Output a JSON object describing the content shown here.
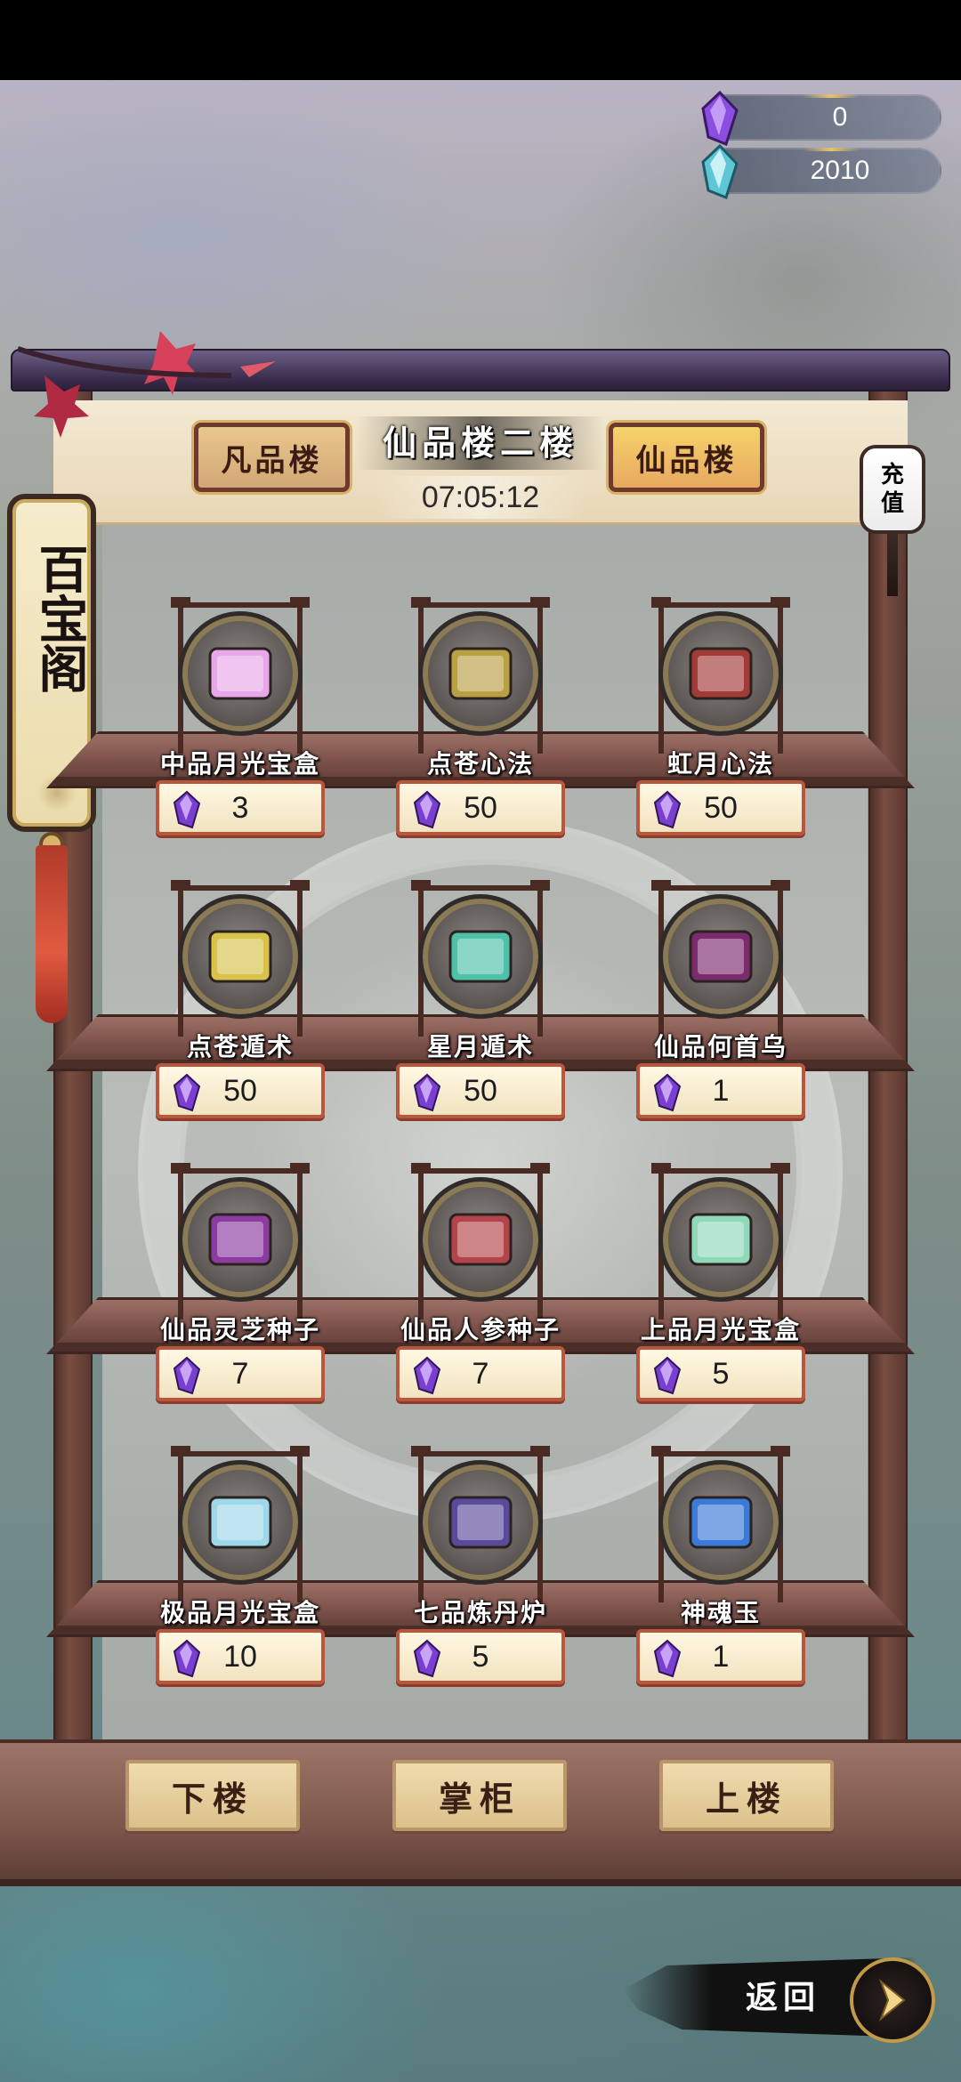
{
  "currency": {
    "purple": {
      "value": "0",
      "icon": "purple-gem-icon"
    },
    "blue": {
      "value": "2010",
      "icon": "blue-crystal-icon"
    }
  },
  "header": {
    "left_nav": "凡品楼",
    "title": "仙品楼二楼",
    "right_nav": "仙品楼",
    "timer": "07:05:12",
    "recharge_line1": "充",
    "recharge_line2": "值"
  },
  "side_sign": {
    "text": "百宝阁"
  },
  "items": [
    {
      "name": "中品月光宝盒",
      "price": "3",
      "icon": "pink-treasure-box-icon",
      "color": "#e8a7e8"
    },
    {
      "name": "点苍心法",
      "price": "50",
      "icon": "yellow-scroll-book-icon",
      "color": "#b9a042"
    },
    {
      "name": "虹月心法",
      "price": "50",
      "icon": "red-scroll-book-icon",
      "color": "#a23a36"
    },
    {
      "name": "点苍遁术",
      "price": "50",
      "icon": "golden-scroll-icon",
      "color": "#d8c24a"
    },
    {
      "name": "星月遁术",
      "price": "50",
      "icon": "teal-scroll-icon",
      "color": "#4ec1a8"
    },
    {
      "name": "仙品何首乌",
      "price": "1",
      "icon": "purple-root-herb-icon",
      "color": "#7b2a6e"
    },
    {
      "name": "仙品灵芝种子",
      "price": "7",
      "icon": "purple-lingzhi-mushroom-icon",
      "color": "#8c3b9e"
    },
    {
      "name": "仙品人参种子",
      "price": "7",
      "icon": "ginseng-figure-icon",
      "color": "#b4444c"
    },
    {
      "name": "上品月光宝盒",
      "price": "5",
      "icon": "green-treasure-box-icon",
      "color": "#8fd8b8"
    },
    {
      "name": "极品月光宝盒",
      "price": "10",
      "icon": "blue-treasure-box-icon",
      "color": "#9fd8e8"
    },
    {
      "name": "七品炼丹炉",
      "price": "5",
      "icon": "alchemy-furnace-icon",
      "color": "#5a4a9a"
    },
    {
      "name": "神魂玉",
      "price": "1",
      "icon": "blue-soul-jade-icon",
      "color": "#3a7bd8"
    }
  ],
  "buttons": {
    "down": "下楼",
    "shopkeeper": "掌柜",
    "up": "上楼",
    "back": "返回"
  },
  "colors": {
    "price_border": "#b8573d",
    "gem_purple": "#7a3fd0",
    "wood_dark": "#4a2b24"
  }
}
